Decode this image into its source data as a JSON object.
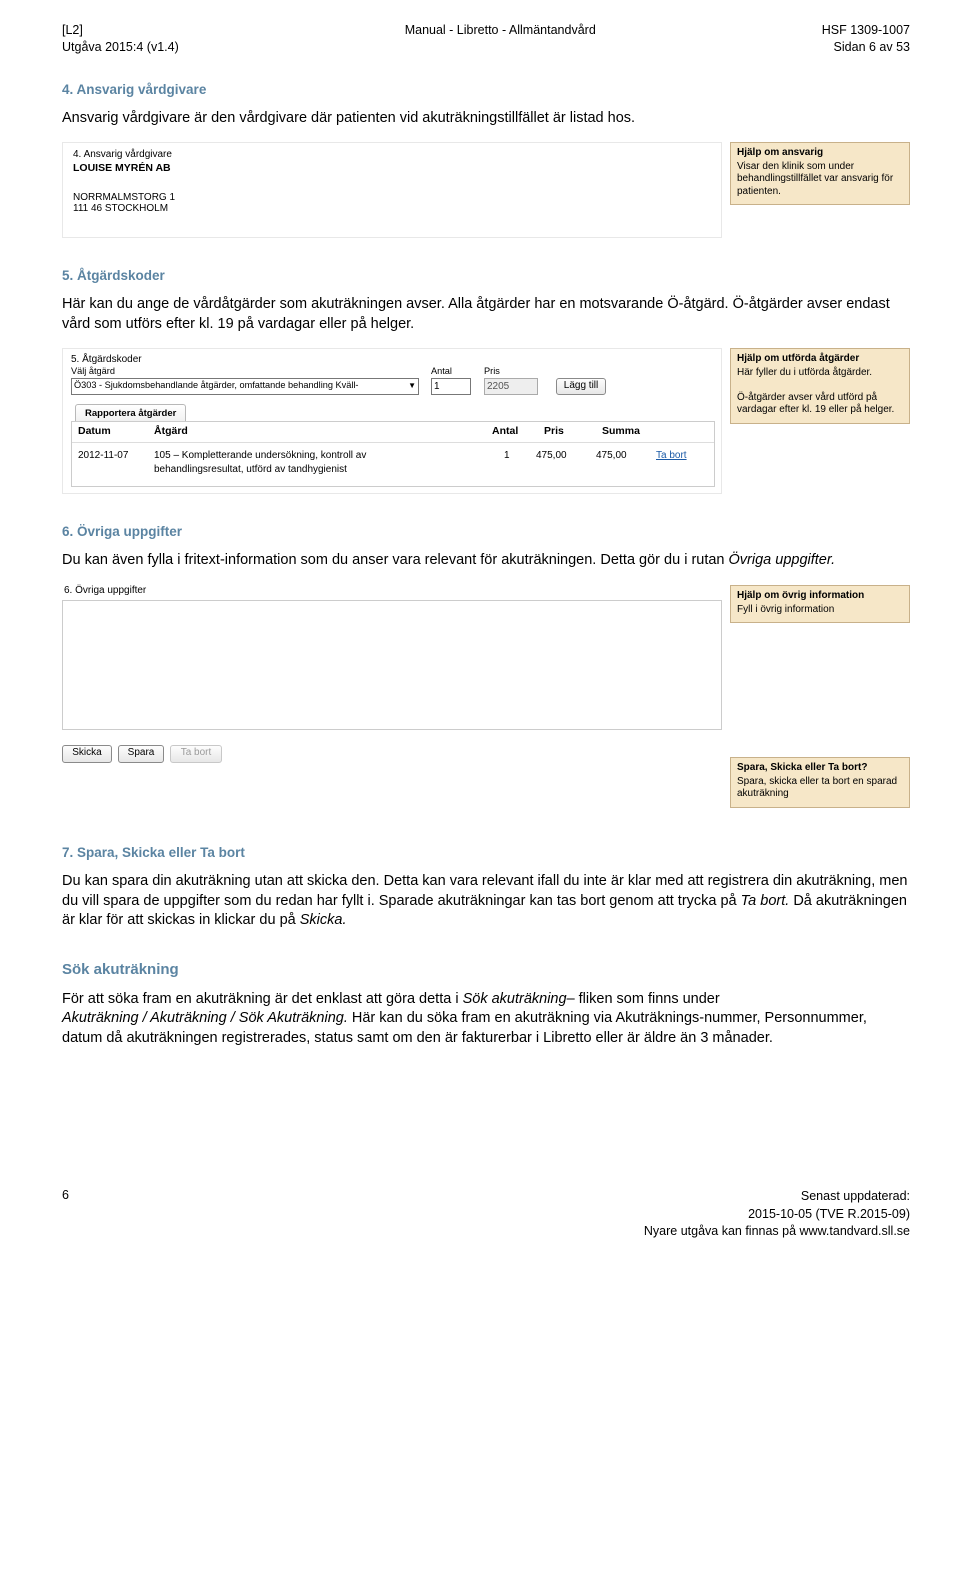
{
  "header": {
    "left_top": "[L2]",
    "left_bottom": "Utgåva 2015:4 (v1.4)",
    "center": "Manual - Libretto - Allmäntandvård",
    "right_top": "HSF 1309-1007",
    "right_bottom": "Sidan 6 av 53"
  },
  "s4": {
    "title": "4. Ansvarig vårdgivare",
    "text": "Ansvarig vårdgivare är den vårdgivare där patienten vid akuträkningstillfället är listad hos.",
    "panel_head": "4. Ansvarig vårdgivare",
    "org": "LOUISE MYRÉN AB",
    "addr1": "NORRMALMSTORG 1",
    "addr2": "111 46 STOCKHOLM",
    "help_title": "Hjälp om ansvarig",
    "help_text": "Visar den klinik som under behandlingstillfället var ansvarig för patienten."
  },
  "s5": {
    "title": "5. Åtgärdskoder",
    "text": "Här kan du ange de vårdåtgärder som akuträkningen avser. Alla åtgärder har en motsvarande Ö-åtgärd. Ö-åtgärder avser endast vård som utförs efter kl. 19 på vardagar eller på helger.",
    "panel_head": "5. Åtgärdskoder",
    "valj_label": "Välj åtgärd",
    "valj_value": "Ö303 - Sjukdomsbehandlande åtgärder, omfattande behandling Kväll-",
    "antal_label": "Antal",
    "antal_value": "1",
    "pris_label": "Pris",
    "pris_value": "2205",
    "add": "Lägg till",
    "rapport_tab": "Rapportera åtgärder",
    "col_datum": "Datum",
    "col_atgard": "Åtgärd",
    "col_antal": "Antal",
    "col_pris": "Pris",
    "col_summa": "Summa",
    "row_date": "2012-11-07",
    "row_desc1": "105 – Kompletterande undersökning, kontroll av",
    "row_desc2": "behandlingsresultat, utförd av tandhygienist",
    "row_antal": "1",
    "row_pris": "475,00",
    "row_summa": "475,00",
    "row_link": "Ta bort",
    "help_title": "Hjälp om utförda åtgärder",
    "help_line1": "Här fyller du i utförda åtgärder.",
    "help_line2": "Ö-åtgärder avser vård utförd på vardagar efter kl. 19 eller på helger."
  },
  "s6": {
    "title": "6. Övriga uppgifter",
    "text_prefix": "Du kan även fylla i fritext-information som du anser vara relevant för akuträkningen. Detta gör du i rutan ",
    "text_italic": "Övriga uppgifter.",
    "panel_head": "6. Övriga uppgifter",
    "help_title": "Hjälp om övrig information",
    "help_text": "Fyll i övrig information",
    "btn_skicka": "Skicka",
    "btn_spara": "Spara",
    "btn_tabort": "Ta bort",
    "help2_title": "Spara, Skicka eller Ta bort?",
    "help2_text": "Spara, skicka eller ta bort en sparad akuträkning"
  },
  "s7": {
    "title": "7. Spara, Skicka eller Ta bort",
    "para1a": "Du kan spara din akuträkning utan att skicka den. Detta kan vara relevant ifall du inte är klar med att registrera din akuträkning, men du vill spara de uppgifter som du redan har fyllt i. Sparade akuträkningar kan tas bort genom att trycka på ",
    "para1b": "Ta bort.",
    "para1c": " Då akuträkningen är klar för att skickas in klickar du på ",
    "para1d": "Skicka."
  },
  "search": {
    "title": "Sök akuträkning",
    "p1a": "För att söka fram en akuträkning är det enklast att göra detta i ",
    "p1b": "Sök akuträkning",
    "p1c": "– fliken som finns under ",
    "p1d": "Akuträkning / Akuträkning / Sök Akuträkning.",
    "p1e": " Här kan du söka fram en akuträkning via Akuträknings-nummer, Personnummer, datum då akuträkningen registrerades, status samt om den är fakturerbar i Libretto eller är äldre än 3 månader."
  },
  "footer": {
    "page_no": "6",
    "r1": "Senast uppdaterad:",
    "r2": "2015-10-05 (TVE R.2015-09)",
    "r3": "Nyare utgåva kan finnas på www.tandvard.sll.se"
  }
}
